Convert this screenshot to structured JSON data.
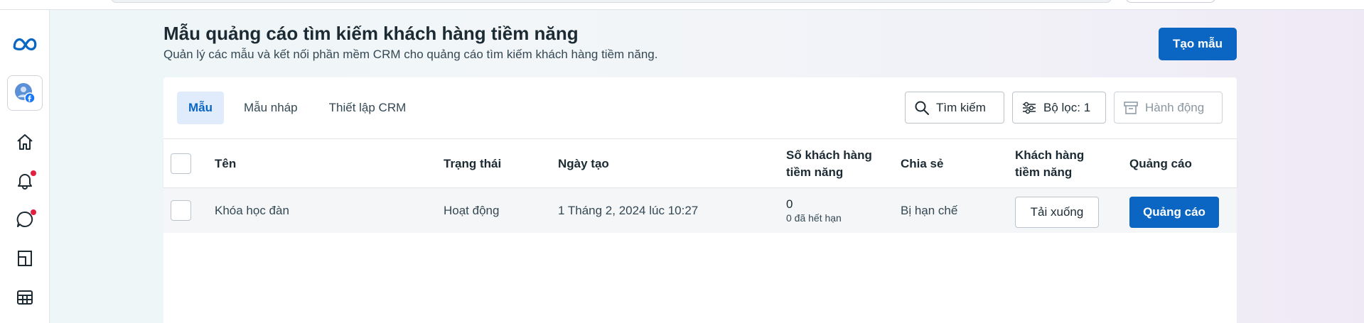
{
  "header": {
    "title": "Mẫu quảng cáo tìm kiếm khách hàng tiềm năng",
    "subtitle": "Quản lý các mẫu và kết nối phần mềm CRM cho quảng cáo tìm kiếm khách hàng tiềm năng.",
    "create_label": "Tạo mẫu"
  },
  "tabs": [
    {
      "label": "Mẫu",
      "active": true
    },
    {
      "label": "Mẫu nháp",
      "active": false
    },
    {
      "label": "Thiết lập CRM",
      "active": false
    }
  ],
  "toolbar": {
    "search_label": "Tìm kiếm",
    "filter_label": "Bộ lọc: 1",
    "actions_label": "Hành động"
  },
  "table": {
    "columns": {
      "name": "Tên",
      "status": "Trạng thái",
      "created": "Ngày tạo",
      "leads_line1": "Số khách hàng",
      "leads_line2": "tiềm năng",
      "sharing": "Chia sẻ",
      "download_line1": "Khách hàng",
      "download_line2": "tiềm năng",
      "ads": "Quảng cáo"
    },
    "rows": [
      {
        "name": "Khóa học đàn",
        "status": "Hoạt động",
        "created": "1 Tháng 2, 2024 lúc 10:27",
        "leads": "0",
        "expired": "0 đã hết hạn",
        "sharing": "Bị hạn chế",
        "download_label": "Tải xuống",
        "ads_label": "Quảng cáo"
      }
    ]
  },
  "colors": {
    "accent": "#0a66c2",
    "notification": "#e41e3f"
  },
  "icons": [
    "meta-logo-icon",
    "account-icon",
    "home-icon",
    "bell-icon",
    "chat-icon",
    "pages-icon",
    "table-icon",
    "search-icon",
    "filter-icon",
    "archive-icon"
  ]
}
